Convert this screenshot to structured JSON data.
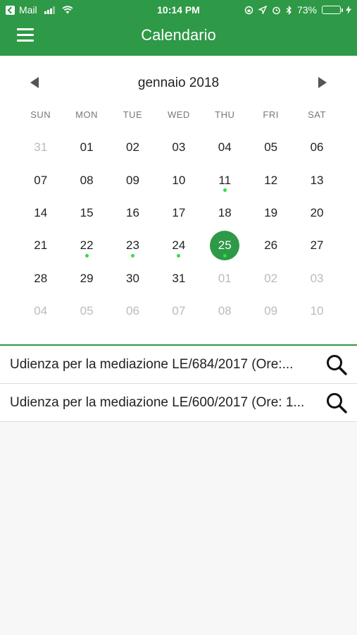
{
  "status_bar": {
    "back_app": "Mail",
    "time": "10:14 PM",
    "battery": "73%",
    "battery_level": 0.73
  },
  "nav": {
    "title": "Calendario"
  },
  "calendar": {
    "month_label": "gennaio 2018",
    "weekdays": [
      "SUN",
      "MON",
      "TUE",
      "WED",
      "THU",
      "FRI",
      "SAT"
    ],
    "days": [
      {
        "label": "31",
        "muted": true
      },
      {
        "label": "01"
      },
      {
        "label": "02"
      },
      {
        "label": "03"
      },
      {
        "label": "04"
      },
      {
        "label": "05"
      },
      {
        "label": "06"
      },
      {
        "label": "07"
      },
      {
        "label": "08"
      },
      {
        "label": "09"
      },
      {
        "label": "10"
      },
      {
        "label": "11",
        "event": true
      },
      {
        "label": "12"
      },
      {
        "label": "13"
      },
      {
        "label": "14"
      },
      {
        "label": "15"
      },
      {
        "label": "16"
      },
      {
        "label": "17"
      },
      {
        "label": "18"
      },
      {
        "label": "19"
      },
      {
        "label": "20"
      },
      {
        "label": "21"
      },
      {
        "label": "22",
        "event": true
      },
      {
        "label": "23",
        "event": true
      },
      {
        "label": "24",
        "event": true
      },
      {
        "label": "25",
        "event": true,
        "selected": true
      },
      {
        "label": "26"
      },
      {
        "label": "27"
      },
      {
        "label": "28"
      },
      {
        "label": "29"
      },
      {
        "label": "30"
      },
      {
        "label": "31"
      },
      {
        "label": "01",
        "muted": true
      },
      {
        "label": "02",
        "muted": true
      },
      {
        "label": "03",
        "muted": true
      },
      {
        "label": "04",
        "muted": true
      },
      {
        "label": "05",
        "muted": true
      },
      {
        "label": "06",
        "muted": true
      },
      {
        "label": "07",
        "muted": true
      },
      {
        "label": "08",
        "muted": true
      },
      {
        "label": "09",
        "muted": true
      },
      {
        "label": "10",
        "muted": true
      }
    ]
  },
  "events": [
    {
      "title": "Udienza per la mediazione LE/684/2017 (Ore:...",
      "icon": "search-icon"
    },
    {
      "title": "Udienza per la mediazione LE/600/2017 (Ore: 1...",
      "icon": "search-icon"
    }
  ],
  "colors": {
    "accent": "#2e9946",
    "event_dot": "#30e040"
  }
}
